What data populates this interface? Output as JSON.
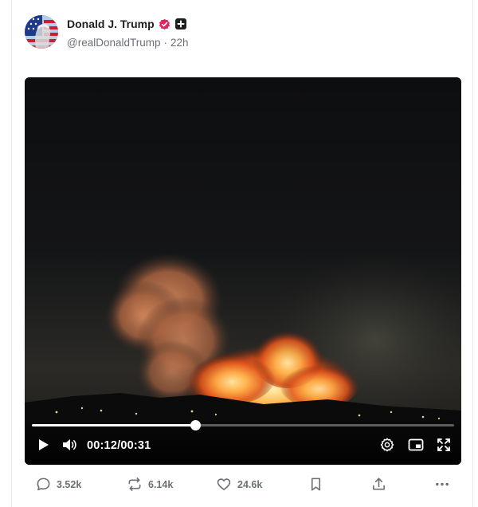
{
  "post": {
    "author_name": "Donald J. Trump",
    "handle": "@realDonaldTrump",
    "separator": "·",
    "time_ago": "22h"
  },
  "video": {
    "current_time": "00:12",
    "time_separator": "/",
    "duration": "00:31",
    "progress": 0.387
  },
  "actions": {
    "replies": "3.52k",
    "reposts": "6.14k",
    "likes": "24.6k"
  },
  "colors": {
    "verified": "#e0245e",
    "text_muted": "#6b6f76",
    "text_primary": "#1d1f23"
  },
  "icons": [
    "verified-badge-icon",
    "plus-badge-icon",
    "play-icon",
    "volume-icon",
    "settings-icon",
    "picture-in-picture-icon",
    "fullscreen-icon",
    "reply-icon",
    "repost-icon",
    "like-icon",
    "bookmark-icon",
    "share-icon",
    "more-icon"
  ]
}
